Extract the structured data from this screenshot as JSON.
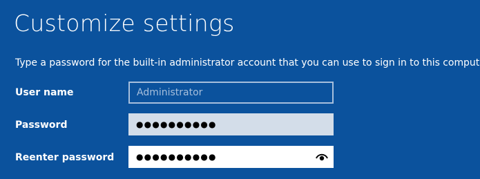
{
  "page": {
    "title": "Customize settings",
    "instructions": "Type a password for the built-in administrator account that you can use to sign in to this computer."
  },
  "fields": {
    "username": {
      "label": "User name",
      "placeholder": "Administrator",
      "value": ""
    },
    "password": {
      "label": "Password",
      "masked_value": "●●●●●●●●●●"
    },
    "reenter": {
      "label": "Reenter password",
      "masked_value": "●●●●●●●●●●",
      "reveal_icon": "eye-icon"
    }
  },
  "colors": {
    "background": "#0b529d",
    "text": "#ffffff",
    "disabled_border": "#a7bfdc",
    "password_field_bg": "#d3dde9",
    "active_field_bg": "#ffffff"
  }
}
